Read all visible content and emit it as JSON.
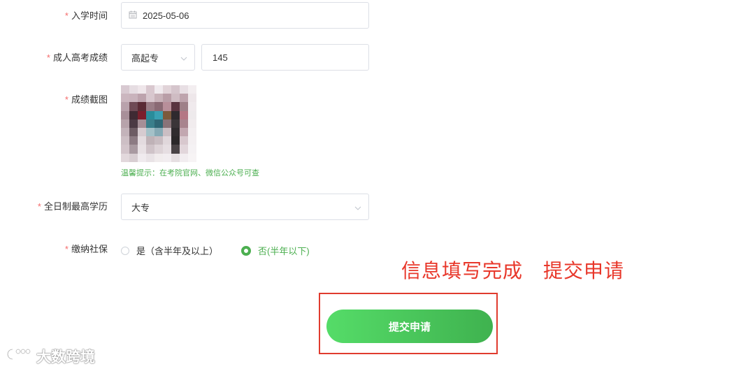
{
  "form": {
    "required_mark": "*",
    "enroll_time": {
      "label": "入学时间",
      "value": "2025-05-06",
      "icon": "calendar-icon"
    },
    "exam_score": {
      "label": "成人高考成绩",
      "level": "高起专",
      "score": "145",
      "icon": "chevron-down-icon"
    },
    "screenshot": {
      "label": "成绩截图",
      "hint": "温馨提示：在考院官网、微信公众号可查"
    },
    "education": {
      "label": "全日制最高学历",
      "value": "大专",
      "icon": "chevron-down-icon"
    },
    "social_security": {
      "label": "缴纳社保",
      "options": [
        {
          "label": "是（含半年及以上）",
          "selected": false
        },
        {
          "label": "否(半年以下)",
          "selected": true
        }
      ]
    },
    "submit_label": "提交申请"
  },
  "annotation": {
    "text": "信息填写完成　提交申请",
    "color": "#e8372a"
  },
  "watermark": {
    "text": "大数跨境"
  },
  "colors": {
    "accent": "#4caf50",
    "required": "#f56c6c",
    "button_start": "#55dc68",
    "button_end": "#3fb24f"
  }
}
